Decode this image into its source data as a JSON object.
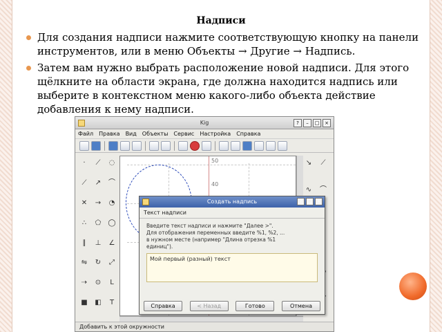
{
  "slide": {
    "title": "Надписи",
    "bullets": [
      "Для создания надписи нажмите соответствующую кнопку на панели инструментов, или в меню Объекты → Другие → Надпись.",
      "Затем вам нужно выбрать расположение новой надписи. Для этого щёлкните на области экрана, где должна находится надпись или выберите в контекстном меню какого-либо объекта действие добавления к нему надписи."
    ]
  },
  "window": {
    "title": "Kig",
    "menu": [
      "Файл",
      "Правка",
      "Вид",
      "Объекты",
      "Сервис",
      "Настройка",
      "Справка"
    ],
    "status": "Добавить к этой окружности"
  },
  "canvas": {
    "axis_labels": [
      "50",
      "40"
    ]
  },
  "dialog": {
    "title": "Создать надпись",
    "section": "Текст надписи",
    "instructions": "Введите текст надписи и нажмите \"Далее >\".\nДля отображения переменных введите %1, %2, ...\nв нужном месте (например \"Длина отрезка %1\nединиц\").",
    "input_value": "Мой первый (разный) текст",
    "buttons": {
      "help": "Справка",
      "back": "< Назад",
      "finish": "Готово",
      "cancel": "Отмена"
    }
  },
  "colors": {
    "bullet": "#e8974f",
    "dialog_title": "#3d62a9",
    "accent_ball": "#f06a2a"
  }
}
